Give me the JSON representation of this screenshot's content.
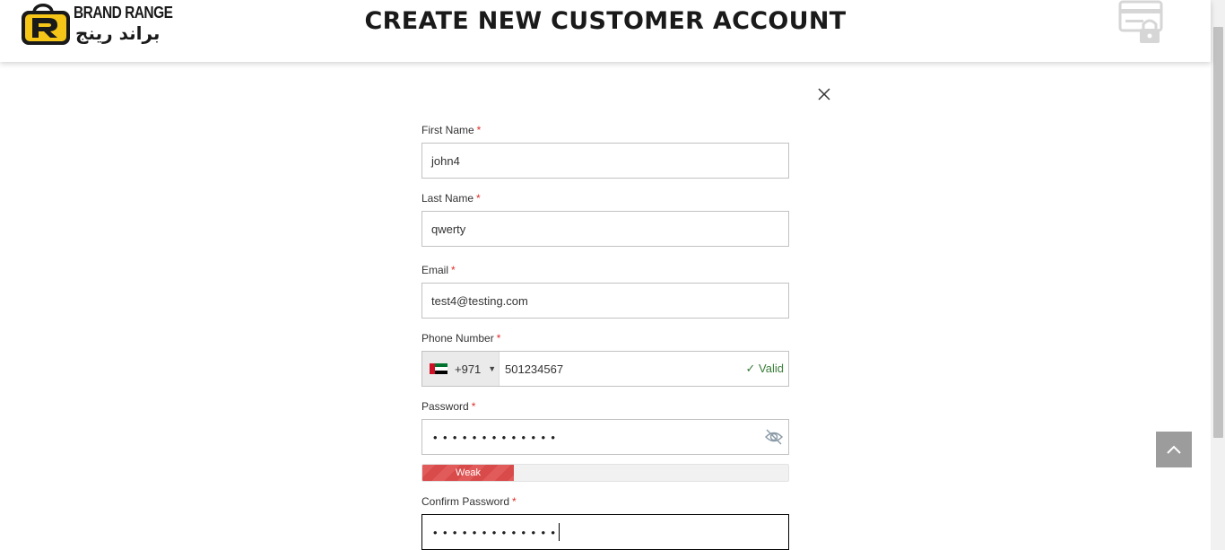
{
  "header": {
    "logo_text_en": "BRAND RANGE",
    "logo_text_ar": "براند رينج",
    "title": "CREATE NEW CUSTOMER ACCOUNT",
    "secure_icon": "secure-card-lock-icon"
  },
  "form": {
    "close_icon": "close-icon",
    "first_name": {
      "label": "First Name",
      "required": "*",
      "value": "john4"
    },
    "last_name": {
      "label": "Last Name",
      "required": "*",
      "value": "qwerty"
    },
    "email": {
      "label": "Email",
      "required": "*",
      "value": "test4@testing.com"
    },
    "phone": {
      "label": "Phone Number",
      "required": "*",
      "country_code": "+971",
      "value": "501234567",
      "validation": "✓ Valid"
    },
    "password": {
      "label": "Password",
      "required": "*",
      "masked_value": "•••••••••••••",
      "strength_label": "Weak",
      "strength_level": 0.25
    },
    "confirm_password": {
      "label": "Confirm Password",
      "required": "*",
      "masked_value": "•••••••••••••"
    }
  },
  "colors": {
    "required": "#e02b27",
    "valid": "#3a7d3a",
    "weak": "#e25b5b",
    "logo_yellow": "#f5c518"
  },
  "back_to_top_icon": "chevron-up-icon"
}
